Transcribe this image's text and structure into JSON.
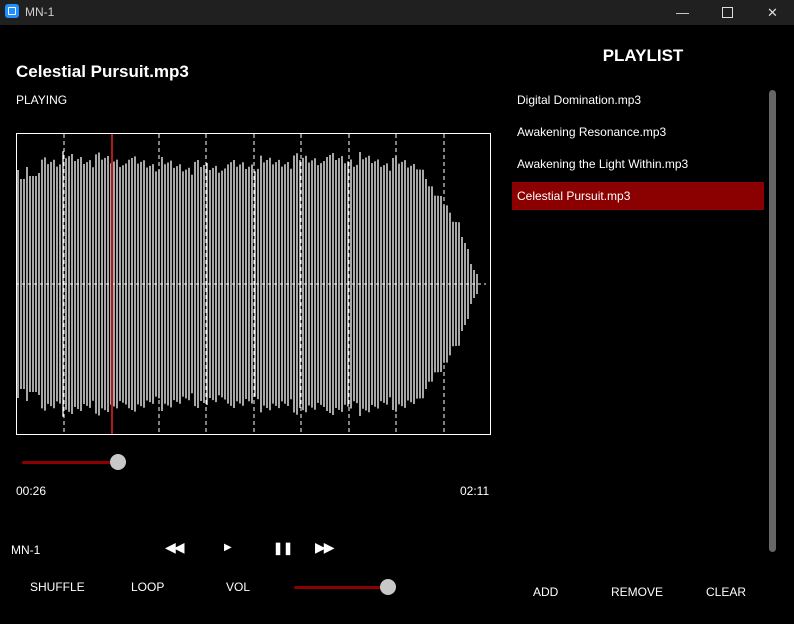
{
  "window": {
    "title": "MN-1",
    "minimize": "—",
    "close": "✕"
  },
  "player": {
    "track_title": "Celestial Pursuit.mp3",
    "status": "PLAYING",
    "elapsed": "00:26",
    "total": "02:11",
    "progress": 0.2,
    "app_label": "MN-1",
    "controls": {
      "prev": "◀◀",
      "play": "▶",
      "pause": "❚❚",
      "next": "▶▶"
    },
    "options": {
      "shuffle": "SHUFFLE",
      "loop": "LOOP",
      "vol": "VOL"
    },
    "volume": 0.92
  },
  "playlist": {
    "heading": "PLAYLIST",
    "items": [
      "Digital Domination.mp3",
      "Awakening Resonance.mp3",
      "Awakening the Light Within.mp3",
      "Celestial Pursuit.mp3"
    ],
    "active_index": 3,
    "buttons": {
      "add": "ADD",
      "remove": "REMOVE",
      "clear": "CLEAR"
    }
  },
  "colors": {
    "accent": "#8b0000",
    "playhead": "#b01818",
    "waveform": "#ffffff",
    "background": "#000000",
    "titlebar": "#202020"
  }
}
